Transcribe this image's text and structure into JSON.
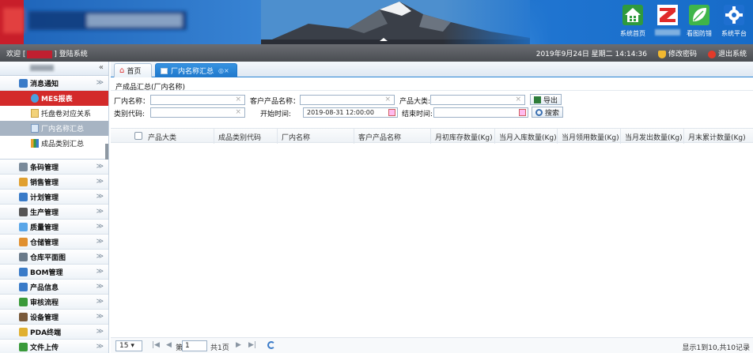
{
  "header": {
    "buttons": [
      {
        "id": "home",
        "label": "系统首页",
        "icon": "house-icon",
        "color": "#2f9a3d"
      },
      {
        "id": "z",
        "label": "",
        "icon": "z-logo-icon",
        "color": "#e02a2a"
      },
      {
        "id": "anti",
        "label": "看图防错",
        "icon": "leaf-icon",
        "color": "#3fb54a"
      },
      {
        "id": "platform",
        "label": "系统平台",
        "icon": "gear-icon",
        "color": "#1e6fd0"
      }
    ]
  },
  "infobar": {
    "welcome_prefix": "欢迎 [",
    "welcome_suffix": "] 登陆系统",
    "datetime": "2019年9月24日 星期二 14:14:36",
    "change_password": "修改密码",
    "logout": "退出系统"
  },
  "sidebar": {
    "collapse": "«",
    "groups": [
      {
        "label": "消息通知",
        "icon": "bell-icon",
        "color": "#3a7bc8",
        "arrow": "≫"
      },
      {
        "label": "条码管理",
        "icon": "barcode-icon",
        "color": "#7a8a9a",
        "arrow": "≫"
      },
      {
        "label": "销售管理",
        "icon": "sales-icon",
        "color": "#e0a030",
        "arrow": "≫"
      },
      {
        "label": "计划管理",
        "icon": "plan-icon",
        "color": "#3a7bc8",
        "arrow": "≫"
      },
      {
        "label": "生产管理",
        "icon": "list-icon",
        "color": "#555555",
        "arrow": "≫"
      },
      {
        "label": "质量管理",
        "icon": "bulb-icon",
        "color": "#5aa6e8",
        "arrow": "≫"
      },
      {
        "label": "仓储管理",
        "icon": "chart-icon",
        "color": "#e09030",
        "arrow": "≫"
      },
      {
        "label": "仓库平面图",
        "icon": "map-icon",
        "color": "#6a7a8a",
        "arrow": "≫"
      },
      {
        "label": "BOM管理",
        "icon": "bom-icon",
        "color": "#3a7bc8",
        "arrow": "≫"
      },
      {
        "label": "产品信息",
        "icon": "product-icon",
        "color": "#3a7bc8",
        "arrow": "≫"
      },
      {
        "label": "审核流程",
        "icon": "flow-icon",
        "color": "#3a9a3a",
        "arrow": "≫"
      },
      {
        "label": "设备管理",
        "icon": "tool-icon",
        "color": "#7a5a3a",
        "arrow": "≫"
      },
      {
        "label": "PDA终端",
        "icon": "pda-icon",
        "color": "#e0b030",
        "arrow": "≫"
      },
      {
        "label": "文件上传",
        "icon": "upload-icon",
        "color": "#3a9a3a",
        "arrow": "≫"
      }
    ],
    "mes": {
      "label": "MES报表"
    },
    "sub_items": [
      {
        "label": "托盘卷对应关系",
        "active": false
      },
      {
        "label": "厂内名称汇总",
        "active": true
      },
      {
        "label": "成品类别汇总",
        "active": false
      }
    ]
  },
  "tabs": [
    {
      "label": "首页",
      "icon": "home-icon"
    },
    {
      "label": "厂内名称汇总",
      "icon": "document-icon"
    }
  ],
  "page_title": "产成品汇总(厂内名称)",
  "form": {
    "factory_name_label": "厂内名称：",
    "factory_name_value": "",
    "customer_name_label": "客户产品名称：",
    "customer_name_value": "",
    "category_label": "产品大类:",
    "category_value": "",
    "export_label": "导出",
    "type_code_label": "类别代码:",
    "type_code_value": "",
    "start_label": "开始时间:",
    "start_value": "2019-08-31 12:00:00",
    "end_label": "结束时间:",
    "end_value": "",
    "search_label": "搜索",
    "clear_glyph": "×"
  },
  "table": {
    "columns": [
      "产品大类",
      "成品类别代码",
      "厂内名称",
      "客户产品名称",
      "月初库存数量(Kg)",
      "当月入库数量(Kg)",
      "当月领用数量(Kg)",
      "当月发出数量(Kg)",
      "月末累计数量(Kg)"
    ]
  },
  "pager": {
    "page_size": "15",
    "page_prefix": "第",
    "page_value": "1",
    "page_total": "共1页",
    "summary": "显示1到10,共10记录"
  }
}
